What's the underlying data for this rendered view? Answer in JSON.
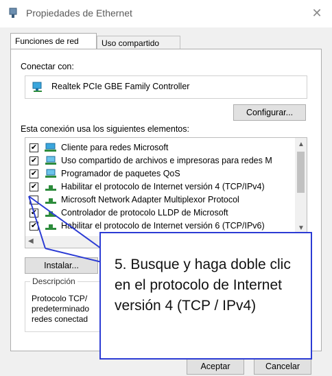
{
  "window": {
    "title": "Propiedades de Ethernet"
  },
  "tabs": [
    "Funciones de red",
    "Uso compartido"
  ],
  "connect": {
    "label": "Conectar con:",
    "adapter": "Realtek PCIe GBE Family Controller",
    "configure_button": "Configurar..."
  },
  "list_label": "Esta conexión usa los siguientes elementos:",
  "items": [
    {
      "label": "Cliente para redes Microsoft",
      "checked": true,
      "icon": "network-client-icon"
    },
    {
      "label": "Uso compartido de archivos e impresoras para redes M",
      "checked": true,
      "icon": "file-sharing-icon"
    },
    {
      "label": "Programador de paquetes QoS",
      "checked": true,
      "icon": "qos-icon"
    },
    {
      "label": "Habilitar el protocolo de Internet versión 4 (TCP/IPv4)",
      "checked": true,
      "icon": "protocol-icon"
    },
    {
      "label": "Microsoft Network Adapter Multiplexor Protocol",
      "checked": false,
      "icon": "protocol-icon"
    },
    {
      "label": "Controlador de protocolo LLDP de Microsoft",
      "checked": true,
      "icon": "protocol-icon"
    },
    {
      "label": "Habilitar el protocolo de Internet versión 6 (TCP/IPv6)",
      "checked": true,
      "icon": "protocol-icon"
    }
  ],
  "buttons": {
    "install": "Instalar...",
    "accept": "Aceptar",
    "cancel": "Cancelar"
  },
  "description": {
    "title": "Descripción",
    "lines": [
      "Protocolo TCP/",
      "predeterminado",
      "redes conectad"
    ]
  },
  "callout": {
    "text": "5. Busque y haga doble clic en el protocolo de Internet versión 4 (TCP / IPv4)"
  },
  "colors": {
    "callout_border": "#2b3bd4"
  }
}
